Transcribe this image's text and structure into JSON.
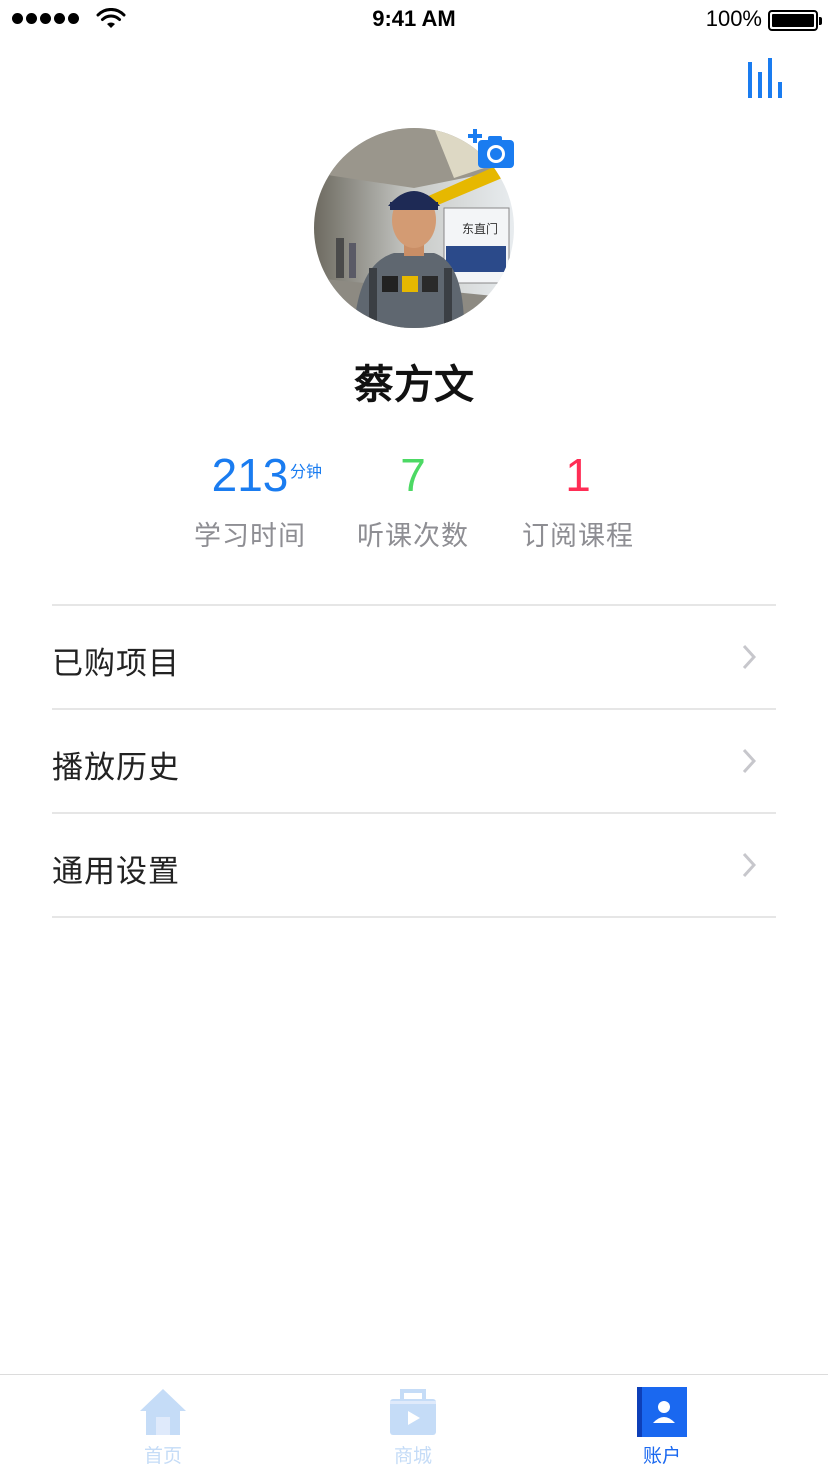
{
  "status_bar": {
    "time": "9:41 AM",
    "battery_percent": "100%"
  },
  "profile": {
    "name": "蔡方文",
    "avatar_alt": "user photo"
  },
  "stats": [
    {
      "value": "213",
      "unit": "分钟",
      "label": "学习时间",
      "color": "#1a7cf0"
    },
    {
      "value": "7",
      "unit": "",
      "label": "听课次数",
      "color": "#4cd964"
    },
    {
      "value": "1",
      "unit": "",
      "label": "订阅课程",
      "color": "#ff2d55"
    }
  ],
  "menu": [
    {
      "label": "已购项目"
    },
    {
      "label": "播放历史"
    },
    {
      "label": "通用设置"
    }
  ],
  "tabs": [
    {
      "label": "首页",
      "active": false,
      "icon": "home-icon"
    },
    {
      "label": "商城",
      "active": false,
      "icon": "store-icon"
    },
    {
      "label": "账户",
      "active": true,
      "icon": "account-icon"
    }
  ],
  "colors": {
    "accent": "#1a7cf0",
    "inactive_tab": "#c5dcf7",
    "active_tab": "#1a68f0"
  }
}
